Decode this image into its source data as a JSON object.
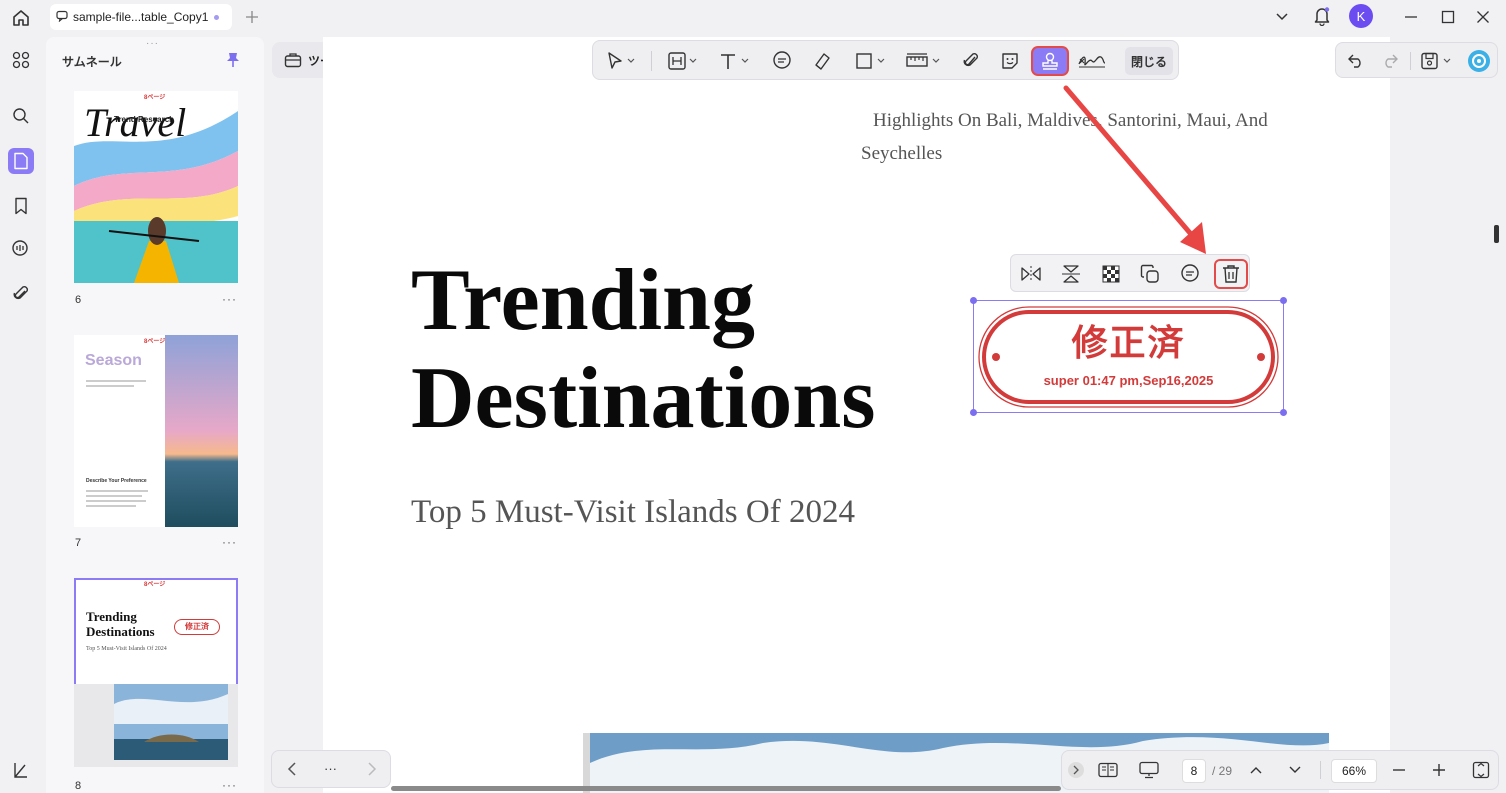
{
  "tab": {
    "title": "sample-file...table_Copy1"
  },
  "user": {
    "avatar_letter": "K"
  },
  "sidebar": {
    "title": "サムネール",
    "thumbnails": [
      {
        "page": "6",
        "more": "···",
        "title": "Travel",
        "subtitle": "Trend Research",
        "tag": "8ページ"
      },
      {
        "page": "7",
        "more": "···",
        "title": "Season",
        "heading": "Describe Your Preference",
        "tag": "8ページ"
      },
      {
        "page": "8",
        "more": "···",
        "title": "Trending Destinations",
        "subtitle": "Top 5 Must-Visit Islands Of 2024",
        "stamp": "修正済",
        "tag": "8ページ"
      }
    ]
  },
  "toolbar": {
    "tools_label": "ツール",
    "close_label": "閉じる"
  },
  "document": {
    "highlights": "Highlights On Bali, Maldives, Santorini, Maui, And Seychelles",
    "title_line1": "Trending",
    "title_line2": "Destinations",
    "subtitle": "Top 5 Must-Visit Islands Of 2024"
  },
  "stamp": {
    "text": "修正済",
    "subtext": "super 01:47 pm,Sep16,2025",
    "color": "#d33a3a"
  },
  "pagination": {
    "current": "8",
    "total": "/ 29",
    "zoom": "66%",
    "more": "···"
  },
  "colors": {
    "accent": "#8b7cf6",
    "highlight_box": "#e34b4b",
    "arrow": "#e84545"
  }
}
